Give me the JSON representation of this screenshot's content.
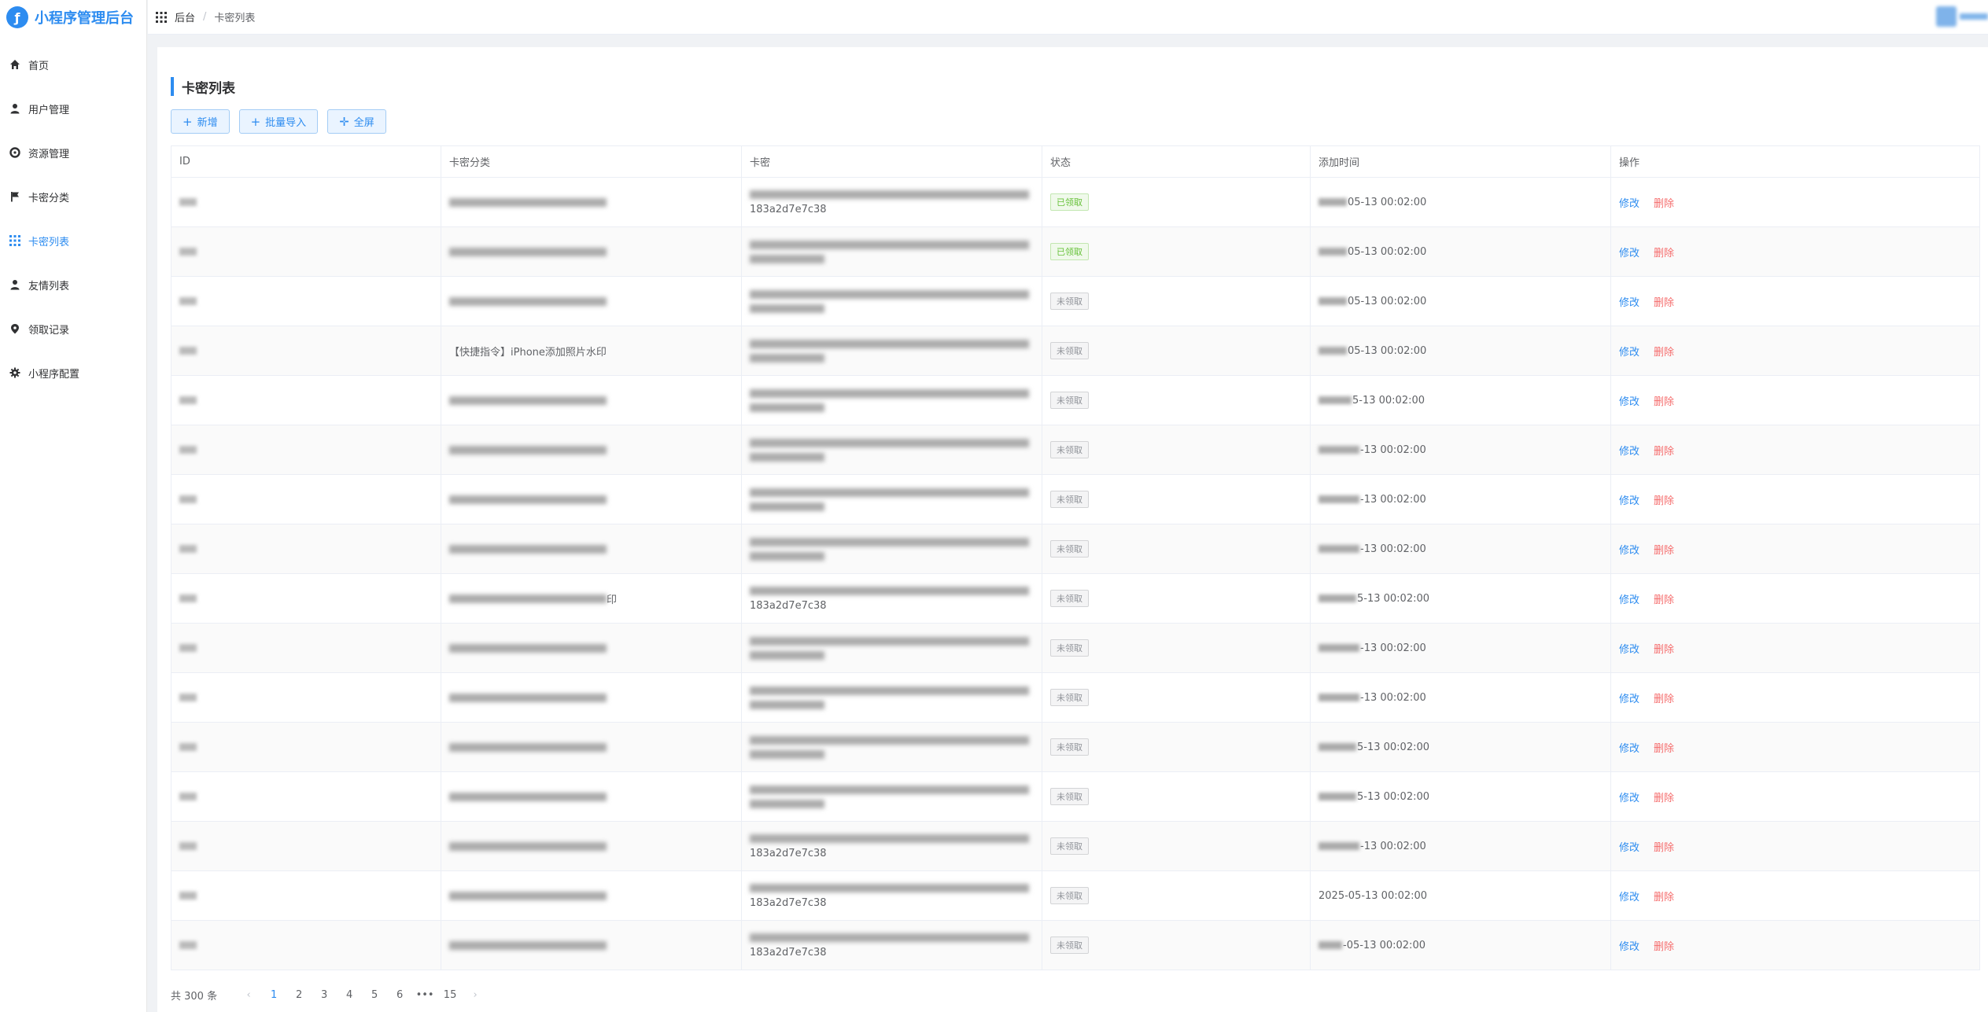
{
  "app": {
    "title": "小程序管理后台",
    "logo_glyph": "ƒ"
  },
  "sidebar": {
    "items": [
      {
        "label": "首页",
        "icon": "home-icon",
        "active": false
      },
      {
        "label": "用户管理",
        "icon": "user-icon",
        "active": false
      },
      {
        "label": "资源管理",
        "icon": "resource-icon",
        "active": false
      },
      {
        "label": "卡密分类",
        "icon": "flag-icon",
        "active": false
      },
      {
        "label": "卡密列表",
        "icon": "grid-icon",
        "active": true
      },
      {
        "label": "友情列表",
        "icon": "user-icon",
        "active": false
      },
      {
        "label": "领取记录",
        "icon": "pin-icon",
        "active": false
      },
      {
        "label": "小程序配置",
        "icon": "gear-icon",
        "active": false
      }
    ]
  },
  "breadcrumb": {
    "home": "后台",
    "separator": "/",
    "current": "卡密列表"
  },
  "page": {
    "title": "卡密列表"
  },
  "toolbar": {
    "add_label": "新增",
    "import_label": "批量导入",
    "fullscreen_label": "全屏"
  },
  "table": {
    "columns": [
      "ID",
      "卡密分类",
      "卡密",
      "状态",
      "添加时间",
      "操作"
    ],
    "rows": [
      {
        "category_text": "",
        "category_suffix": "",
        "card_code": "183a2d7e7c38",
        "status": "已领取",
        "status_type": "ok",
        "time_suffix": "05-13 00:02:00",
        "time_blur": 36
      },
      {
        "category_text": "",
        "category_suffix": "",
        "card_code": "",
        "status": "已领取",
        "status_type": "ok",
        "time_suffix": "05-13 00:02:00",
        "time_blur": 36
      },
      {
        "category_text": "",
        "category_suffix": "",
        "card_code": "",
        "status": "未领取",
        "status_type": "no",
        "time_suffix": "05-13 00:02:00",
        "time_blur": 36
      },
      {
        "category_text": "【快捷指令】iPhone添加照片水印",
        "category_suffix": "",
        "card_code": "",
        "status": "未领取",
        "status_type": "no",
        "time_suffix": "05-13 00:02:00",
        "time_blur": 36
      },
      {
        "category_text": "",
        "category_suffix": "",
        "card_code": "",
        "status": "未领取",
        "status_type": "no",
        "time_suffix": "5-13 00:02:00",
        "time_blur": 42
      },
      {
        "category_text": "",
        "category_suffix": "",
        "card_code": "",
        "status": "未领取",
        "status_type": "no",
        "time_suffix": "-13 00:02:00",
        "time_blur": 52
      },
      {
        "category_text": "",
        "category_suffix": "",
        "card_code": "",
        "status": "未领取",
        "status_type": "no",
        "time_suffix": "-13 00:02:00",
        "time_blur": 52
      },
      {
        "category_text": "",
        "category_suffix": "",
        "card_code": "",
        "status": "未领取",
        "status_type": "no",
        "time_suffix": "-13 00:02:00",
        "time_blur": 52
      },
      {
        "category_text": "",
        "category_suffix": "印",
        "card_code": "183a2d7e7c38",
        "status": "未领取",
        "status_type": "no",
        "time_suffix": "5-13 00:02:00",
        "time_blur": 48
      },
      {
        "category_text": "",
        "category_suffix": "",
        "card_code": "",
        "status": "未领取",
        "status_type": "no",
        "time_suffix": "-13 00:02:00",
        "time_blur": 52
      },
      {
        "category_text": "",
        "category_suffix": "",
        "card_code": "",
        "status": "未领取",
        "status_type": "no",
        "time_suffix": "-13 00:02:00",
        "time_blur": 52
      },
      {
        "category_text": "",
        "category_suffix": "",
        "card_code": "",
        "status": "未领取",
        "status_type": "no",
        "time_suffix": "5-13 00:02:00",
        "time_blur": 48
      },
      {
        "category_text": "",
        "category_suffix": "",
        "card_code": "",
        "status": "未领取",
        "status_type": "no",
        "time_suffix": "5-13 00:02:00",
        "time_blur": 48
      },
      {
        "category_text": "",
        "category_suffix": "",
        "card_code": "183a2d7e7c38",
        "status": "未领取",
        "status_type": "no",
        "time_suffix": "-13 00:02:00",
        "time_blur": 52
      },
      {
        "category_text": "",
        "category_suffix": "",
        "card_code": "183a2d7e7c38",
        "status": "未领取",
        "status_type": "no",
        "time_suffix": "2025-05-13 00:02:00",
        "time_blur": 0
      },
      {
        "category_text": "",
        "category_suffix": "",
        "card_code": "183a2d7e7c38",
        "status": "未领取",
        "status_type": "no",
        "time_suffix": "-05-13 00:02:00",
        "time_blur": 30
      }
    ],
    "edit_label": "修改",
    "delete_label": "删除"
  },
  "pagination": {
    "total": "共 300 条",
    "prev": "‹",
    "next": "›",
    "pages": [
      "1",
      "2",
      "3",
      "4",
      "5",
      "6",
      "•••",
      "15"
    ],
    "current": "1"
  },
  "colors": {
    "accent": "#2d8cf0",
    "success": "#67c23a",
    "danger": "#f56c6c"
  }
}
